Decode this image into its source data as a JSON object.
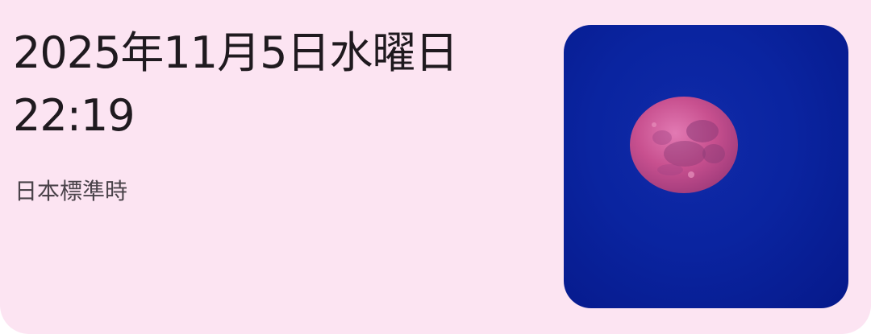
{
  "widget": {
    "date": "2025年11月5日水曜日",
    "time": "22:19",
    "timezone": "日本標準時",
    "image": "full-moon-photo"
  },
  "colors": {
    "card_background": "#fce4f2",
    "text_primary": "#1f1a1f",
    "text_secondary": "#4a434a",
    "sky": "#0a24a0",
    "moon": "#c8508f"
  }
}
